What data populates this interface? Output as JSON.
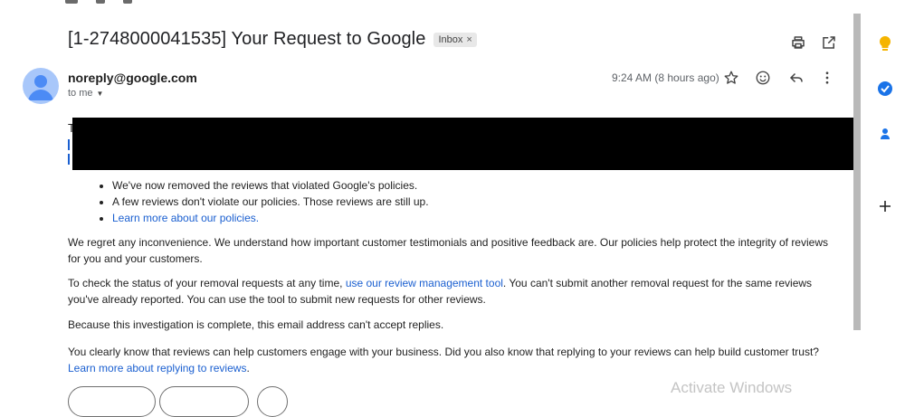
{
  "email": {
    "subject": "[1-2748000041535] Your Request to Google",
    "label": "Inbox",
    "label_close": "×",
    "sender": "noreply@google.com",
    "recipient": "to me",
    "time": "9:24 AM (8 hours ago)",
    "body": {
      "partial_letter_top": "T",
      "bullets": [
        "We've now removed the reviews that violated Google's policies.",
        "A few reviews don't violate our policies. Those reviews are still up."
      ],
      "bullet_link": "Learn more about our policies.",
      "paragraph_1": "We regret any inconvenience. We understand how important customer testimonials and positive feedback are. Our policies help protect the integrity of reviews for you and your customers.",
      "paragraph_2_before": "To check the status of your removal requests at any time, ",
      "paragraph_2_link": "use our review management tool",
      "paragraph_2_after": ". You can't submit another removal request for the same reviews you've already reported. You can use the tool to submit new requests for other reviews.",
      "paragraph_3": "Because this investigation is complete, this email address can't accept replies.",
      "paragraph_4_before": "You clearly know that reviews can help customers engage with your business. Did you also know that replying to your reviews can help build customer trust? ",
      "paragraph_4_link": "Learn more about replying to reviews",
      "paragraph_4_after": "."
    }
  },
  "overlay": {
    "activate_text": "Activate Windows"
  },
  "colors": {
    "link": "#1a5fd0",
    "avatar": "#a8c7fa",
    "avatar_figure": "#4c8bf5"
  },
  "icons": [
    "print-icon",
    "open-new-window-icon",
    "star-icon",
    "emoji-icon",
    "reply-icon",
    "more-vert-icon",
    "chevron-down-icon",
    "keep-icon",
    "tasks-icon",
    "contacts-icon",
    "add-icon"
  ]
}
